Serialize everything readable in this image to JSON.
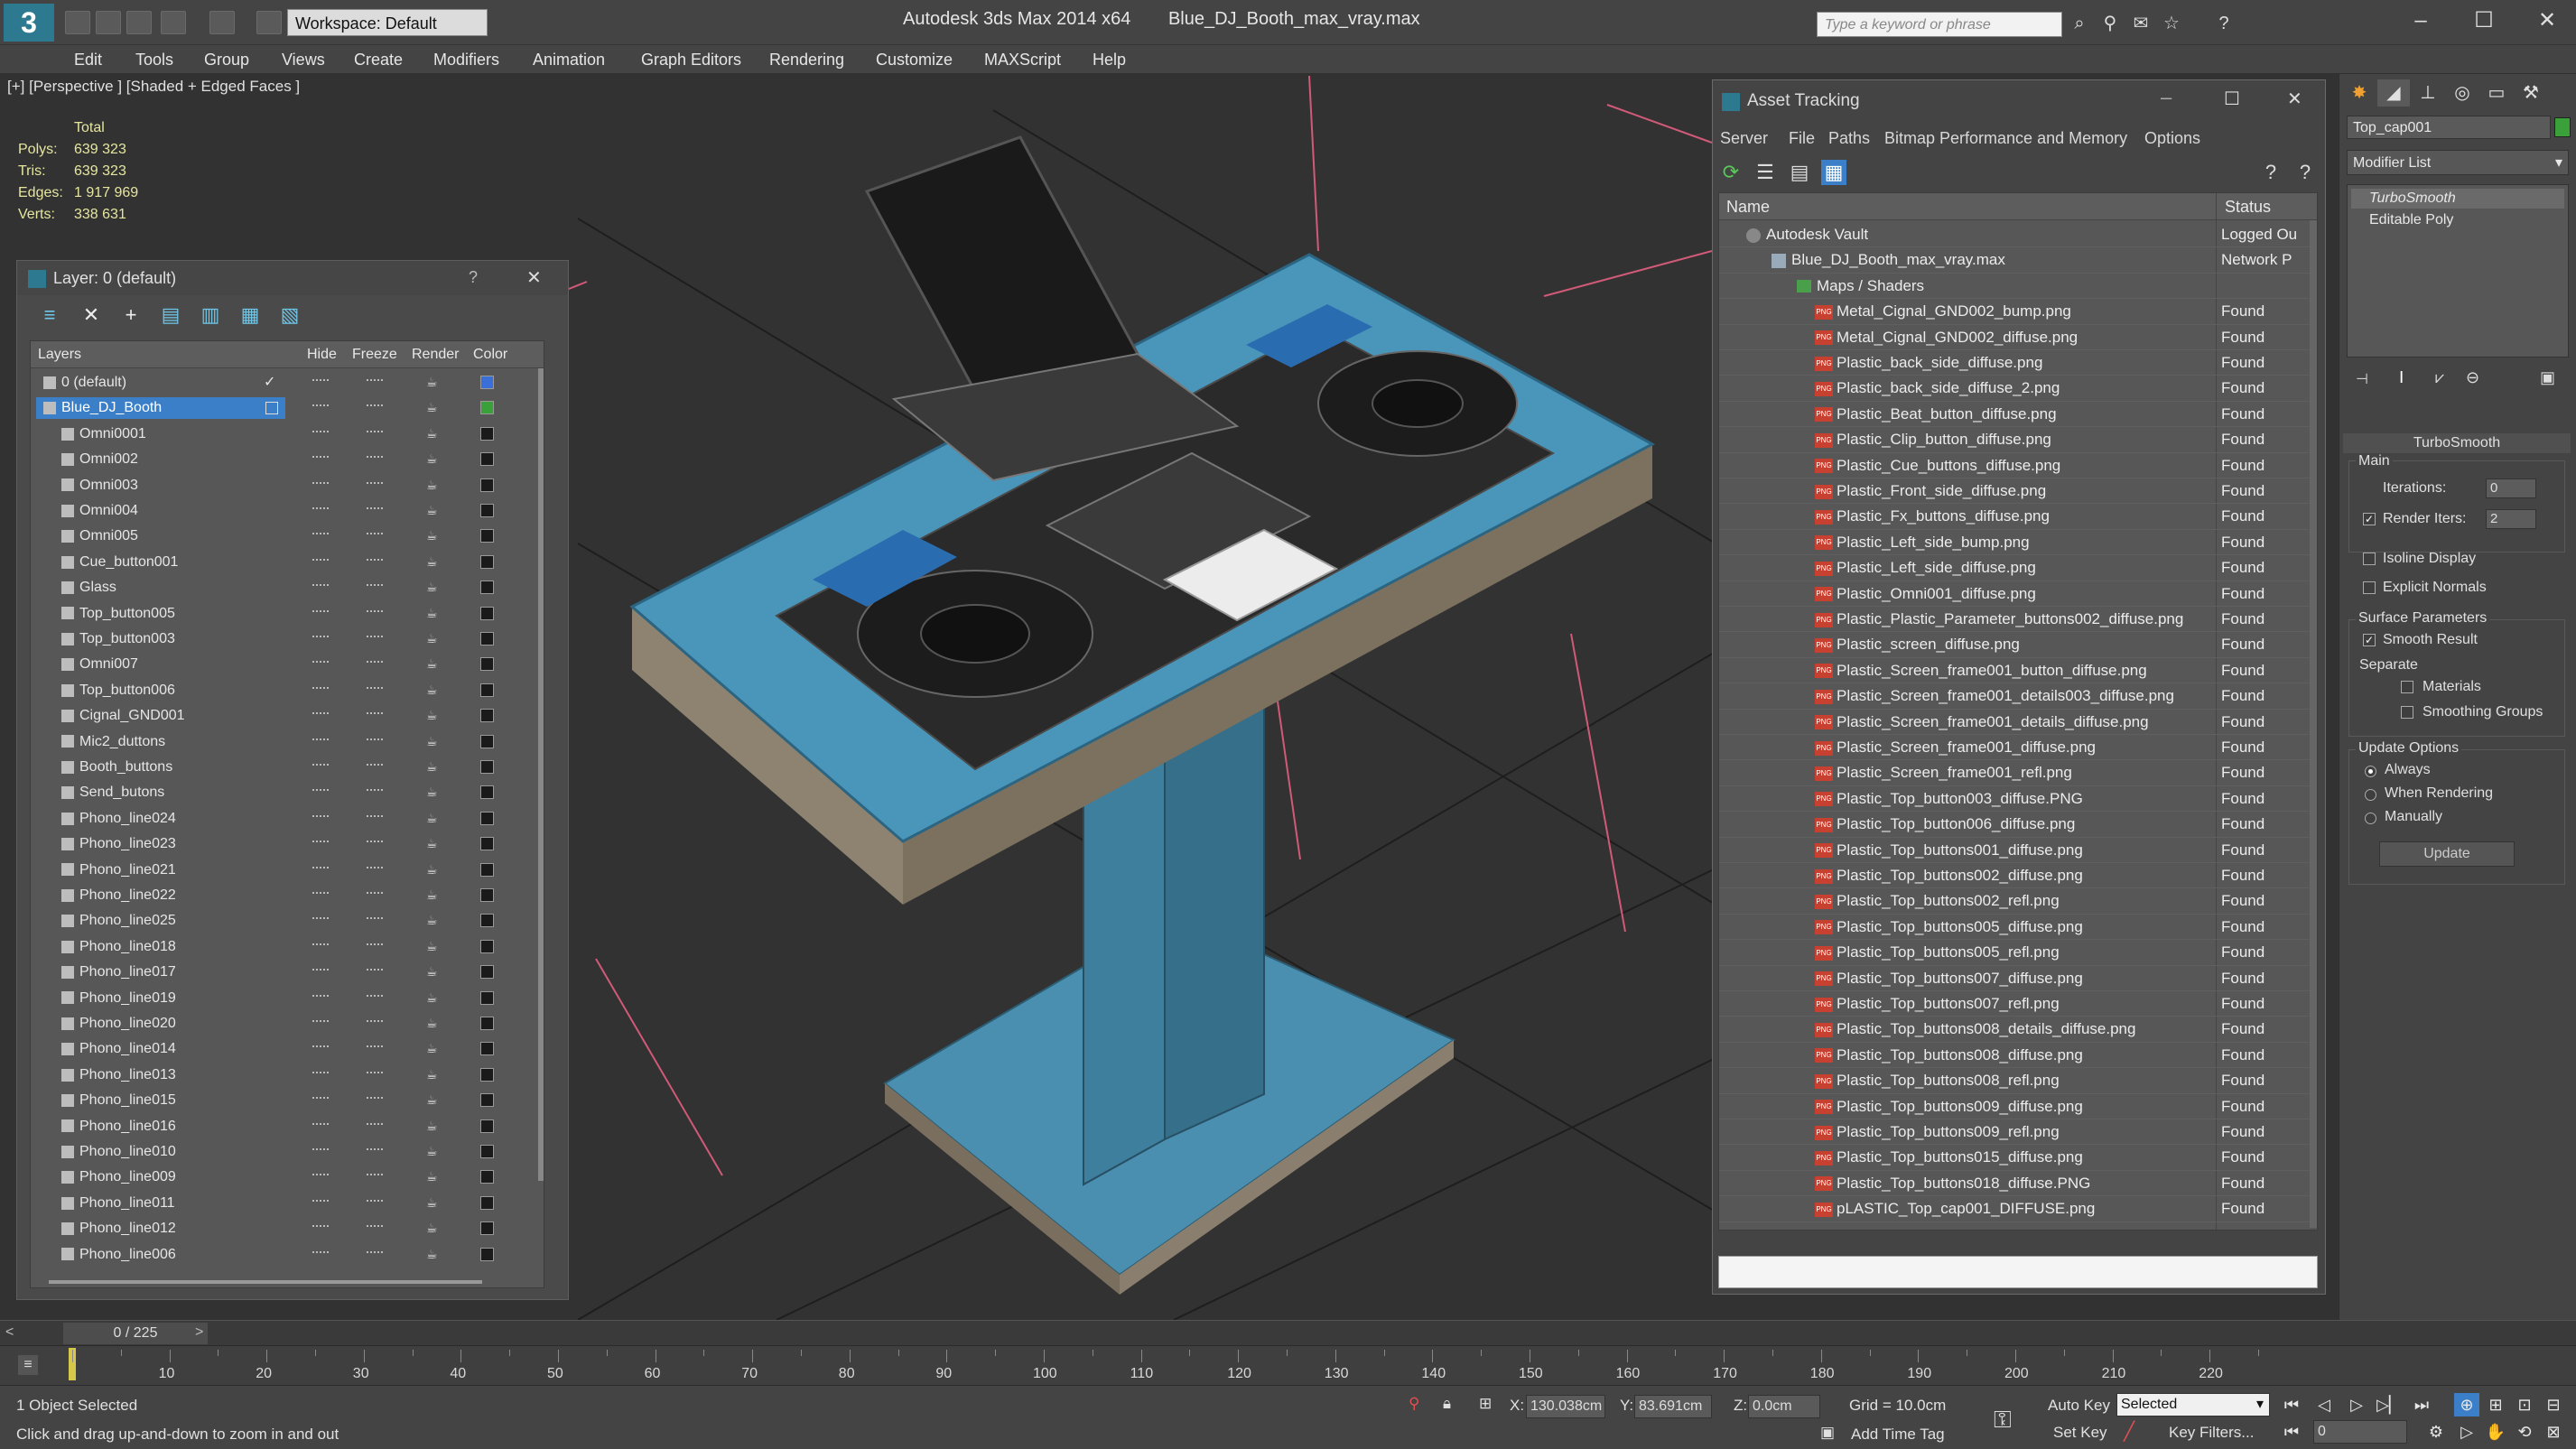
{
  "titlebar": {
    "workspace": "Workspace: Default",
    "app_title": "Autodesk 3ds Max  2014 x64",
    "file_name": "Blue_DJ_Booth_max_vray.max",
    "search_placeholder": "Type a keyword or phrase"
  },
  "menu": [
    "Edit",
    "Tools",
    "Group",
    "Views",
    "Create",
    "Modifiers",
    "Animation",
    "Graph Editors",
    "Rendering",
    "Customize",
    "MAXScript",
    "Help"
  ],
  "viewport": {
    "label": "[+] [Perspective ] [Shaded + Edged Faces ]",
    "stats": {
      "header": "Total",
      "rows": [
        {
          "k": "Polys:",
          "v": "639 323"
        },
        {
          "k": "Tris:",
          "v": "639 323"
        },
        {
          "k": "Edges:",
          "v": "1 917 969"
        },
        {
          "k": "Verts:",
          "v": "338 631"
        }
      ]
    }
  },
  "layer_panel": {
    "title": "Layer: 0 (default)",
    "help": "?",
    "close": "✕",
    "columns": {
      "layers": "Layers",
      "hide": "Hide",
      "freeze": "Freeze",
      "render": "Render",
      "color": "Color"
    },
    "rows": [
      {
        "name": "0 (default)",
        "level": 1,
        "color": "#3a6fd8",
        "check": "✓"
      },
      {
        "name": "Blue_DJ_Booth",
        "level": 1,
        "color": "#3aa03a",
        "selected": true
      },
      {
        "name": "Omni0001",
        "level": 2
      },
      {
        "name": "Omni002",
        "level": 2
      },
      {
        "name": "Omni003",
        "level": 2
      },
      {
        "name": "Omni004",
        "level": 2
      },
      {
        "name": "Omni005",
        "level": 2
      },
      {
        "name": "Cue_button001",
        "level": 2
      },
      {
        "name": "Glass",
        "level": 2
      },
      {
        "name": "Top_button005",
        "level": 2
      },
      {
        "name": "Top_button003",
        "level": 2
      },
      {
        "name": "Omni007",
        "level": 2
      },
      {
        "name": "Top_button006",
        "level": 2
      },
      {
        "name": "Cignal_GND001",
        "level": 2
      },
      {
        "name": "Mic2_duttons",
        "level": 2
      },
      {
        "name": "Booth_buttons",
        "level": 2
      },
      {
        "name": "Send_butons",
        "level": 2
      },
      {
        "name": "Phono_line024",
        "level": 2
      },
      {
        "name": "Phono_line023",
        "level": 2
      },
      {
        "name": "Phono_line021",
        "level": 2
      },
      {
        "name": "Phono_line022",
        "level": 2
      },
      {
        "name": "Phono_line025",
        "level": 2
      },
      {
        "name": "Phono_line018",
        "level": 2
      },
      {
        "name": "Phono_line017",
        "level": 2
      },
      {
        "name": "Phono_line019",
        "level": 2
      },
      {
        "name": "Phono_line020",
        "level": 2
      },
      {
        "name": "Phono_line014",
        "level": 2
      },
      {
        "name": "Phono_line013",
        "level": 2
      },
      {
        "name": "Phono_line015",
        "level": 2
      },
      {
        "name": "Phono_line016",
        "level": 2
      },
      {
        "name": "Phono_line010",
        "level": 2
      },
      {
        "name": "Phono_line009",
        "level": 2
      },
      {
        "name": "Phono_line011",
        "level": 2
      },
      {
        "name": "Phono_line012",
        "level": 2
      },
      {
        "name": "Phono_line006",
        "level": 2
      }
    ]
  },
  "asset_panel": {
    "title": "Asset Tracking",
    "menu": [
      "Server",
      "File",
      "Paths",
      "Bitmap Performance and Memory",
      "Options"
    ],
    "columns": {
      "name": "Name",
      "status": "Status"
    },
    "rows": [
      {
        "name": "Autodesk Vault",
        "status": "Logged Ou",
        "level": 1,
        "kind": "vault"
      },
      {
        "name": "Blue_DJ_Booth_max_vray.max",
        "status": "Network P",
        "level": 2,
        "kind": "file"
      },
      {
        "name": "Maps / Shaders",
        "status": "",
        "level": 3,
        "kind": "folder"
      },
      {
        "name": "Metal_Cignal_GND002_bump.png",
        "status": "Found",
        "level": 4,
        "kind": "png"
      },
      {
        "name": "Metal_Cignal_GND002_diffuse.png",
        "status": "Found",
        "level": 4,
        "kind": "png"
      },
      {
        "name": "Plastic_back_side_diffuse.png",
        "status": "Found",
        "level": 4,
        "kind": "png"
      },
      {
        "name": "Plastic_back_side_diffuse_2.png",
        "status": "Found",
        "level": 4,
        "kind": "png"
      },
      {
        "name": "Plastic_Beat_button_diffuse.png",
        "status": "Found",
        "level": 4,
        "kind": "png"
      },
      {
        "name": "Plastic_Clip_button_diffuse.png",
        "status": "Found",
        "level": 4,
        "kind": "png"
      },
      {
        "name": "Plastic_Cue_buttons_diffuse.png",
        "status": "Found",
        "level": 4,
        "kind": "png"
      },
      {
        "name": "Plastic_Front_side_diffuse.png",
        "status": "Found",
        "level": 4,
        "kind": "png"
      },
      {
        "name": "Plastic_Fx_buttons_diffuse.png",
        "status": "Found",
        "level": 4,
        "kind": "png"
      },
      {
        "name": "Plastic_Left_side_bump.png",
        "status": "Found",
        "level": 4,
        "kind": "png"
      },
      {
        "name": "Plastic_Left_side_diffuse.png",
        "status": "Found",
        "level": 4,
        "kind": "png"
      },
      {
        "name": "Plastic_Omni001_diffuse.png",
        "status": "Found",
        "level": 4,
        "kind": "png"
      },
      {
        "name": "Plastic_Plastic_Parameter_buttons002_diffuse.png",
        "status": "Found",
        "level": 4,
        "kind": "png"
      },
      {
        "name": "Plastic_screen_diffuse.png",
        "status": "Found",
        "level": 4,
        "kind": "png"
      },
      {
        "name": "Plastic_Screen_frame001_button_diffuse.png",
        "status": "Found",
        "level": 4,
        "kind": "png"
      },
      {
        "name": "Plastic_Screen_frame001_details003_diffuse.png",
        "status": "Found",
        "level": 4,
        "kind": "png"
      },
      {
        "name": "Plastic_Screen_frame001_details_diffuse.png",
        "status": "Found",
        "level": 4,
        "kind": "png"
      },
      {
        "name": "Plastic_Screen_frame001_diffuse.png",
        "status": "Found",
        "level": 4,
        "kind": "png"
      },
      {
        "name": "Plastic_Screen_frame001_refl.png",
        "status": "Found",
        "level": 4,
        "kind": "png"
      },
      {
        "name": "Plastic_Top_button003_diffuse.PNG",
        "status": "Found",
        "level": 4,
        "kind": "png"
      },
      {
        "name": "Plastic_Top_button006_diffuse.png",
        "status": "Found",
        "level": 4,
        "kind": "png"
      },
      {
        "name": "Plastic_Top_buttons001_diffuse.png",
        "status": "Found",
        "level": 4,
        "kind": "png"
      },
      {
        "name": "Plastic_Top_buttons002_diffuse.png",
        "status": "Found",
        "level": 4,
        "kind": "png"
      },
      {
        "name": "Plastic_Top_buttons002_refl.png",
        "status": "Found",
        "level": 4,
        "kind": "png"
      },
      {
        "name": "Plastic_Top_buttons005_diffuse.png",
        "status": "Found",
        "level": 4,
        "kind": "png"
      },
      {
        "name": "Plastic_Top_buttons005_refl.png",
        "status": "Found",
        "level": 4,
        "kind": "png"
      },
      {
        "name": "Plastic_Top_buttons007_diffuse.png",
        "status": "Found",
        "level": 4,
        "kind": "png"
      },
      {
        "name": "Plastic_Top_buttons007_refl.png",
        "status": "Found",
        "level": 4,
        "kind": "png"
      },
      {
        "name": "Plastic_Top_buttons008_details_diffuse.png",
        "status": "Found",
        "level": 4,
        "kind": "png"
      },
      {
        "name": "Plastic_Top_buttons008_diffuse.png",
        "status": "Found",
        "level": 4,
        "kind": "png"
      },
      {
        "name": "Plastic_Top_buttons008_refl.png",
        "status": "Found",
        "level": 4,
        "kind": "png"
      },
      {
        "name": "Plastic_Top_buttons009_diffuse.png",
        "status": "Found",
        "level": 4,
        "kind": "png"
      },
      {
        "name": "Plastic_Top_buttons009_refl.png",
        "status": "Found",
        "level": 4,
        "kind": "png"
      },
      {
        "name": "Plastic_Top_buttons015_diffuse.png",
        "status": "Found",
        "level": 4,
        "kind": "png"
      },
      {
        "name": "Plastic_Top_buttons018_diffuse.PNG",
        "status": "Found",
        "level": 4,
        "kind": "png"
      },
      {
        "name": "pLASTIC_Top_cap001_DIFFUSE.png",
        "status": "Found",
        "level": 4,
        "kind": "png"
      }
    ]
  },
  "command_panel": {
    "object_name": "Top_cap001",
    "modifier_list": "Modifier List",
    "stack": [
      "TurboSmooth",
      "Editable Poly"
    ],
    "rollout_title": "TurboSmooth",
    "main_label": "Main",
    "iterations_label": "Iterations:",
    "iterations_value": "0",
    "render_iters_label": "Render Iters:",
    "render_iters_value": "2",
    "isoline_label": "Isoline Display",
    "explicit_normals_label": "Explicit Normals",
    "surface_params_label": "Surface Parameters",
    "smooth_result_label": "Smooth Result",
    "separate_label": "Separate",
    "materials_label": "Materials",
    "smoothing_groups_label": "Smoothing Groups",
    "update_options_label": "Update Options",
    "always_label": "Always",
    "when_rendering_label": "When Rendering",
    "manually_label": "Manually",
    "update_button": "Update"
  },
  "timeline": {
    "frame": "0 / 225",
    "ticks": [
      "10",
      "20",
      "30",
      "40",
      "50",
      "60",
      "70",
      "80",
      "90",
      "100",
      "110",
      "120",
      "130",
      "140",
      "150",
      "160",
      "170",
      "180",
      "190",
      "200",
      "210",
      "220"
    ]
  },
  "status": {
    "selection": "1 Object Selected",
    "prompt": "Click and drag up-and-down to zoom in and out",
    "x_label": "X:",
    "x_value": "130.038cm",
    "y_label": "Y:",
    "y_value": "83.691cm",
    "z_label": "Z:",
    "z_value": "0.0cm",
    "grid": "Grid = 10.0cm",
    "auto_key": "Auto Key",
    "selected": "Selected",
    "set_key": "Set Key",
    "key_filters": "Key Filters...",
    "add_time_tag": "Add Time Tag",
    "frame_value": "0"
  }
}
